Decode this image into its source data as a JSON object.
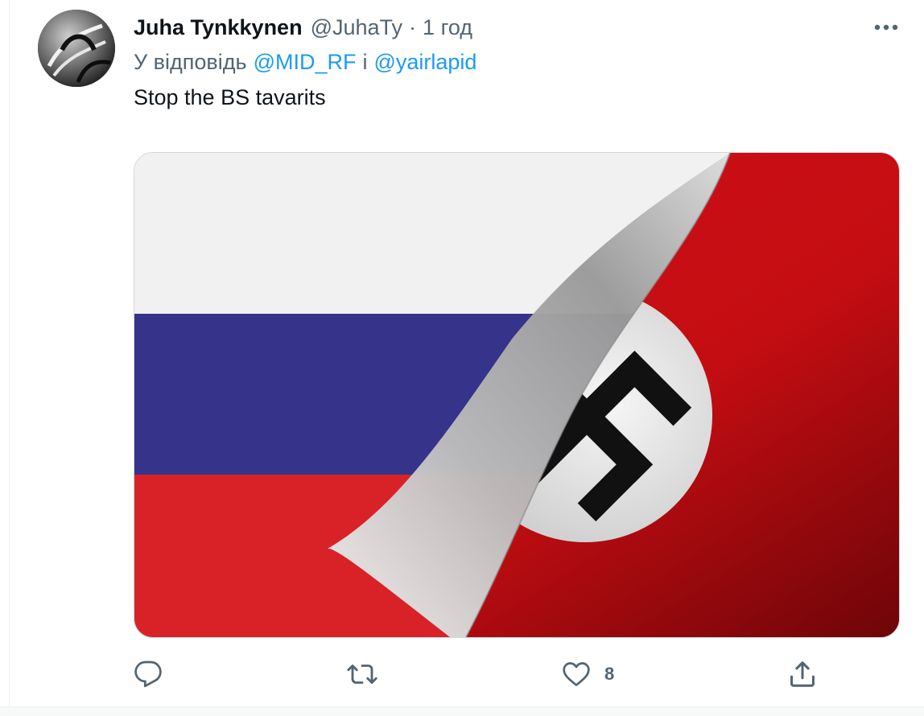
{
  "tweet": {
    "author_name": "Juha Tynkkynen",
    "author_handle": "@JuhaTy",
    "separator": "·",
    "time": "1 год",
    "reply_prefix": "У відповідь",
    "reply_to_1": "@MID_RF",
    "reply_conjunction": "і",
    "reply_to_2": "@yairlapid",
    "text": "Stop the BS tavarits"
  },
  "actions": {
    "reply_count": "",
    "retweet_count": "",
    "like_count": "8",
    "share_count": ""
  },
  "icons": {
    "more": "more-horizontal-icon",
    "reply": "reply-icon",
    "retweet": "retweet-icon",
    "like": "heart-icon",
    "share": "share-icon"
  },
  "colors": {
    "text_primary": "#0f1419",
    "text_secondary": "#536471",
    "link": "#1d9bf0",
    "border": "#cfd9de"
  }
}
